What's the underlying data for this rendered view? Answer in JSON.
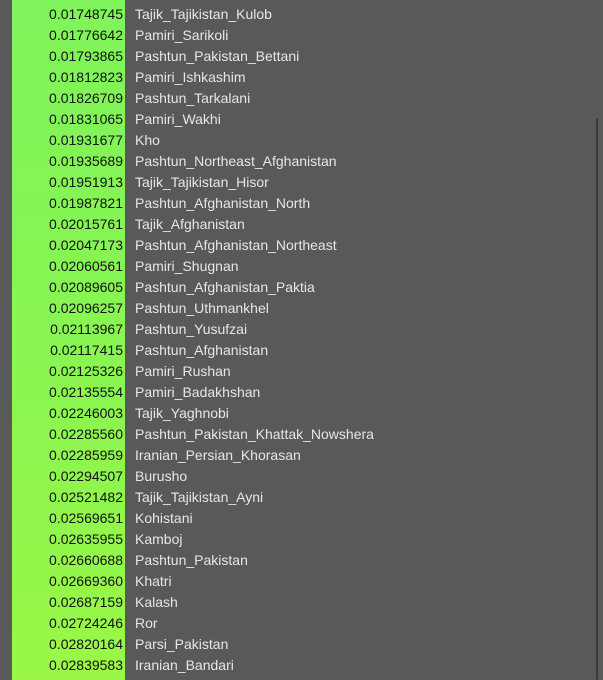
{
  "rows": [
    {
      "value": "0.01748745",
      "name": "Tajik_Tajikistan_Kulob"
    },
    {
      "value": "0.01776642",
      "name": "Pamiri_Sarikoli"
    },
    {
      "value": "0.01793865",
      "name": "Pashtun_Pakistan_Bettani"
    },
    {
      "value": "0.01812823",
      "name": "Pamiri_Ishkashim"
    },
    {
      "value": "0.01826709",
      "name": "Pashtun_Tarkalani"
    },
    {
      "value": "0.01831065",
      "name": "Pamiri_Wakhi"
    },
    {
      "value": "0.01931677",
      "name": "Kho"
    },
    {
      "value": "0.01935689",
      "name": "Pashtun_Northeast_Afghanistan"
    },
    {
      "value": "0.01951913",
      "name": "Tajik_Tajikistan_Hisor"
    },
    {
      "value": "0.01987821",
      "name": "Pashtun_Afghanistan_North"
    },
    {
      "value": "0.02015761",
      "name": "Tajik_Afghanistan"
    },
    {
      "value": "0.02047173",
      "name": "Pashtun_Afghanistan_Northeast"
    },
    {
      "value": "0.02060561",
      "name": "Pamiri_Shugnan"
    },
    {
      "value": "0.02089605",
      "name": "Pashtun_Afghanistan_Paktia"
    },
    {
      "value": "0.02096257",
      "name": "Pashtun_Uthmankhel"
    },
    {
      "value": "0.02113967",
      "name": "Pashtun_Yusufzai"
    },
    {
      "value": "0.02117415",
      "name": "Pashtun_Afghanistan"
    },
    {
      "value": "0.02125326",
      "name": "Pamiri_Rushan"
    },
    {
      "value": "0.02135554",
      "name": "Pamiri_Badakhshan"
    },
    {
      "value": "0.02246003",
      "name": "Tajik_Yaghnobi"
    },
    {
      "value": "0.02285560",
      "name": "Pashtun_Pakistan_Khattak_Nowshera"
    },
    {
      "value": "0.02285959",
      "name": "Iranian_Persian_Khorasan"
    },
    {
      "value": "0.02294507",
      "name": "Burusho"
    },
    {
      "value": "0.02521482",
      "name": "Tajik_Tajikistan_Ayni"
    },
    {
      "value": "0.02569651",
      "name": "Kohistani"
    },
    {
      "value": "0.02635955",
      "name": "Kamboj"
    },
    {
      "value": "0.02660688",
      "name": "Pashtun_Pakistan"
    },
    {
      "value": "0.02669360",
      "name": "Khatri"
    },
    {
      "value": "0.02687159",
      "name": "Kalash"
    },
    {
      "value": "0.02724246",
      "name": "Ror"
    },
    {
      "value": "0.02820164",
      "name": "Parsi_Pakistan"
    },
    {
      "value": "0.02839583",
      "name": "Iranian_Bandari"
    }
  ],
  "colors": {
    "background": "#595959",
    "value_column": "#8af551",
    "name_text": "#e6e6e6",
    "value_text": "#111111"
  }
}
